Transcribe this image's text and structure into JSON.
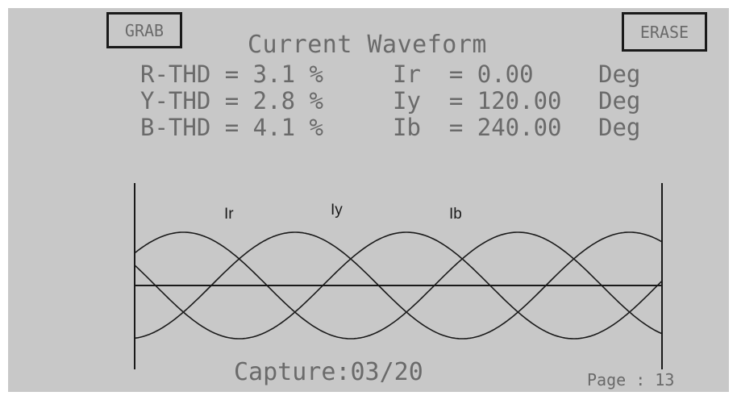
{
  "buttons": {
    "grab": "GRAB",
    "erase": "ERASE"
  },
  "title": "Current Waveform",
  "thd": [
    {
      "label": "R-THD = 3.1 %"
    },
    {
      "label": "Y-THD = 2.8 %"
    },
    {
      "label": "B-THD = 4.1 %"
    }
  ],
  "angles": [
    {
      "text": "Ir  = 0.00",
      "unit": "Deg"
    },
    {
      "text": "Iy  = 120.00",
      "unit": "Deg"
    },
    {
      "text": "Ib  = 240.00",
      "unit": "Deg"
    }
  ],
  "waveform": {
    "labels": [
      "Ir",
      "Iy",
      "Ib"
    ],
    "phase_shifts_deg": [
      0,
      120,
      240
    ]
  },
  "capture": "Capture:03/20",
  "page": "Page : 13",
  "colors": {
    "lcd_background": "#c8c8c8",
    "lcd_text": "#6a6a6a",
    "trace": "#1a1a1a"
  }
}
